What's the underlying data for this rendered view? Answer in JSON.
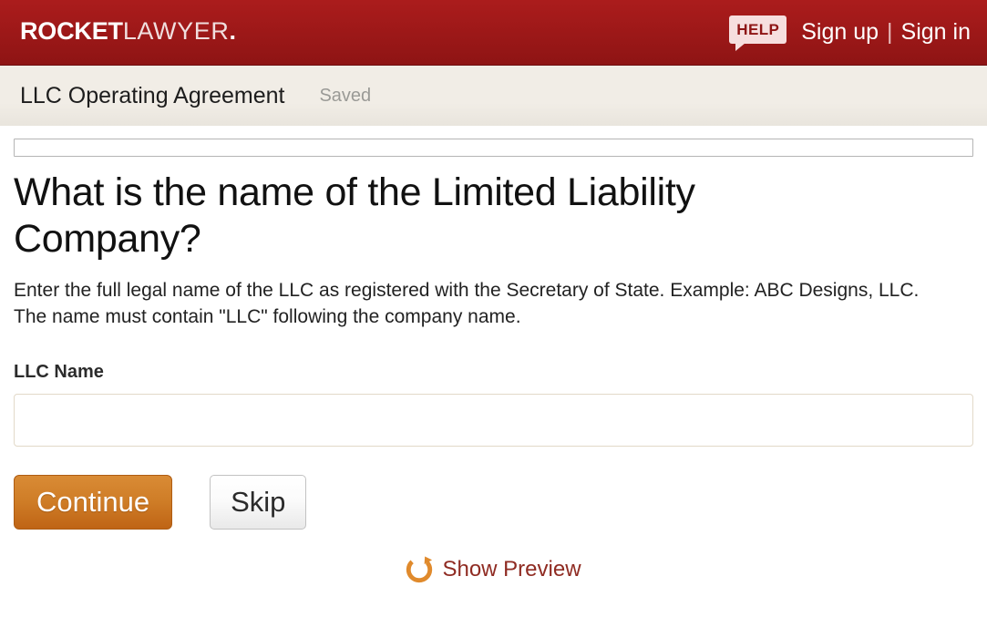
{
  "header": {
    "logo_bold": "ROCKET",
    "logo_light": "LAWYER",
    "logo_dot": ".",
    "help_label": "HELP",
    "sign_up_label": "Sign up",
    "separator": "|",
    "sign_in_label": "Sign in",
    "background_color": "#a01919"
  },
  "document_bar": {
    "title": "LLC Operating Agreement",
    "status": "Saved",
    "background_color": "#f1ede6"
  },
  "progress": {
    "percent": 0
  },
  "main": {
    "question": "What is the name of the Limited Liability Company?",
    "help_text": "Enter the full legal name of the LLC as registered with the Secretary of State. Example: ABC Designs, LLC. The name must contain \"LLC\" following the company name.",
    "field_label": "LLC Name",
    "field_value": "",
    "field_placeholder": ""
  },
  "actions": {
    "continue_label": "Continue",
    "continue_color": "#cf7d27",
    "skip_label": "Skip",
    "preview_label": "Show Preview",
    "preview_color": "#8f2b22",
    "preview_icon": "refresh-icon",
    "preview_icon_color": "#e08a2c"
  }
}
